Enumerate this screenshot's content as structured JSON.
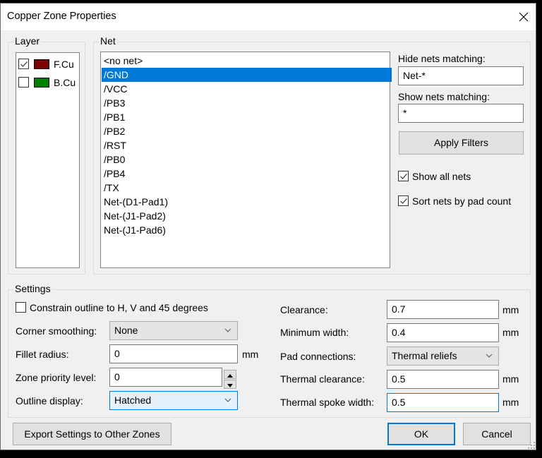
{
  "window": {
    "title": "Copper Zone Properties",
    "close_icon": "close-icon"
  },
  "layer": {
    "label": "Layer",
    "items": [
      {
        "name": "F.Cu",
        "checked": true,
        "color": "#7f0000"
      },
      {
        "name": "B.Cu",
        "checked": false,
        "color": "#008000"
      }
    ]
  },
  "net": {
    "label": "Net",
    "selected": "/GND",
    "items": [
      "<no net>",
      "/GND",
      "/VCC",
      "/PB3",
      "/PB1",
      "/PB2",
      "/RST",
      "/PB0",
      "/PB4",
      "/TX",
      "Net-(D1-Pad1)",
      "Net-(J1-Pad2)",
      "Net-(J1-Pad6)"
    ]
  },
  "filters": {
    "hide_label": "Hide nets matching:",
    "hide_value": "Net-*",
    "show_label": "Show nets matching:",
    "show_value": "*",
    "apply_label": "Apply Filters",
    "show_all_label": "Show all nets",
    "show_all_checked": true,
    "sort_label": "Sort nets by pad count",
    "sort_checked": true
  },
  "settings": {
    "label": "Settings",
    "constrain_label": "Constrain outline to H, V and 45 degrees",
    "constrain_checked": false,
    "corner_label": "Corner smoothing:",
    "corner_value": "None",
    "fillet_label": "Fillet radius:",
    "fillet_value": "0",
    "fillet_unit": "mm",
    "priority_label": "Zone priority level:",
    "priority_value": "0",
    "outline_label": "Outline display:",
    "outline_value": "Hatched",
    "clearance_label": "Clearance:",
    "clearance_value": "0.7",
    "clearance_unit": "mm",
    "minwidth_label": "Minimum width:",
    "minwidth_value": "0.4",
    "minwidth_unit": "mm",
    "pad_label": "Pad connections:",
    "pad_value": "Thermal reliefs",
    "thermal_clearance_label": "Thermal clearance:",
    "thermal_clearance_value": "0.5",
    "thermal_clearance_unit": "mm",
    "spoke_label": "Thermal spoke width:",
    "spoke_value": "0.5",
    "spoke_unit": "mm"
  },
  "buttons": {
    "export_label": "Export Settings to Other Zones",
    "ok_label": "OK",
    "cancel_label": "Cancel"
  }
}
